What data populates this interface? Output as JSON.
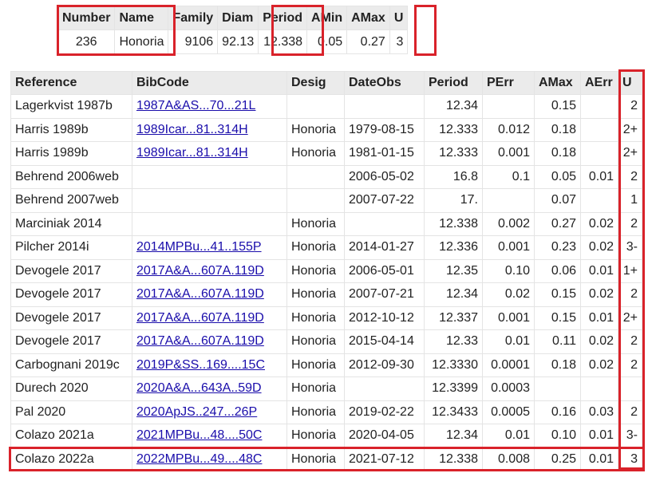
{
  "summary": {
    "headers": [
      "Number",
      "Name",
      "Family",
      "Diam",
      "Period",
      "AMin",
      "AMax",
      "U"
    ],
    "values": [
      "236",
      "Honoria",
      "9106",
      "92.13",
      "12.338",
      "0.05",
      "0.27",
      "3"
    ]
  },
  "references": {
    "headers": [
      "Reference",
      "BibCode",
      "Desig",
      "DateObs",
      "Period",
      "PErr",
      "AMax",
      "AErr",
      "U"
    ],
    "rows": [
      [
        "Lagerkvist 1987b",
        "1987A&AS...70...21L",
        "",
        "",
        "12.34",
        "",
        "0.15",
        "",
        "2"
      ],
      [
        "Harris 1989b",
        "1989Icar...81..314H",
        "Honoria",
        "1979-08-15",
        "12.333",
        "0.012",
        "0.18",
        "",
        "2+"
      ],
      [
        "Harris 1989b",
        "1989Icar...81..314H",
        "Honoria",
        "1981-01-15",
        "12.333",
        "0.001",
        "0.18",
        "",
        "2+"
      ],
      [
        "Behrend 2006web",
        "",
        "",
        "2006-05-02",
        "16.8",
        "0.1",
        "0.05",
        "0.01",
        "2"
      ],
      [
        "Behrend 2007web",
        "",
        "",
        "2007-07-22",
        "17.",
        "",
        "0.07",
        "",
        "1"
      ],
      [
        "Marciniak 2014",
        "",
        "Honoria",
        "",
        "12.338",
        "0.002",
        "0.27",
        "0.02",
        "2"
      ],
      [
        "Pilcher 2014i",
        "2014MPBu...41..155P",
        "Honoria",
        "2014-01-27",
        "12.336",
        "0.001",
        "0.23",
        "0.02",
        "3-"
      ],
      [
        "Devogele 2017",
        "2017A&A...607A.119D",
        "Honoria",
        "2006-05-01",
        "12.35",
        "0.10",
        "0.06",
        "0.01",
        "1+"
      ],
      [
        "Devogele 2017",
        "2017A&A...607A.119D",
        "Honoria",
        "2007-07-21",
        "12.34",
        "0.02",
        "0.15",
        "0.02",
        "2"
      ],
      [
        "Devogele 2017",
        "2017A&A...607A.119D",
        "Honoria",
        "2012-10-12",
        "12.337",
        "0.001",
        "0.15",
        "0.01",
        "2+"
      ],
      [
        "Devogele 2017",
        "2017A&A...607A.119D",
        "Honoria",
        "2015-04-14",
        "12.33",
        "0.01",
        "0.11",
        "0.02",
        "2"
      ],
      [
        "Carbognani 2019c",
        "2019P&SS..169....15C",
        "Honoria",
        "2012-09-30",
        "12.3330",
        "0.0001",
        "0.18",
        "0.02",
        "2"
      ],
      [
        "Durech 2020",
        "2020A&A...643A..59D",
        "Honoria",
        "",
        "12.3399",
        "0.0003",
        "",
        "",
        ""
      ],
      [
        "Pal 2020",
        "2020ApJS..247...26P",
        "Honoria",
        "2019-02-22",
        "12.3433",
        "0.0005",
        "0.16",
        "0.03",
        "2"
      ],
      [
        "Colazo 2021a",
        "2021MPBu...48....50C",
        "Honoria",
        "2020-04-05",
        "12.34",
        "0.01",
        "0.10",
        "0.01",
        "3-"
      ],
      [
        "Colazo 2022a",
        "2022MPBu...49....48C",
        "Honoria",
        "2021-07-12",
        "12.338",
        "0.008",
        "0.25",
        "0.01",
        "3"
      ]
    ]
  },
  "colors": {
    "highlight": "#d9222a",
    "link": "#1a0dab",
    "header_bg": "#ebebeb"
  }
}
